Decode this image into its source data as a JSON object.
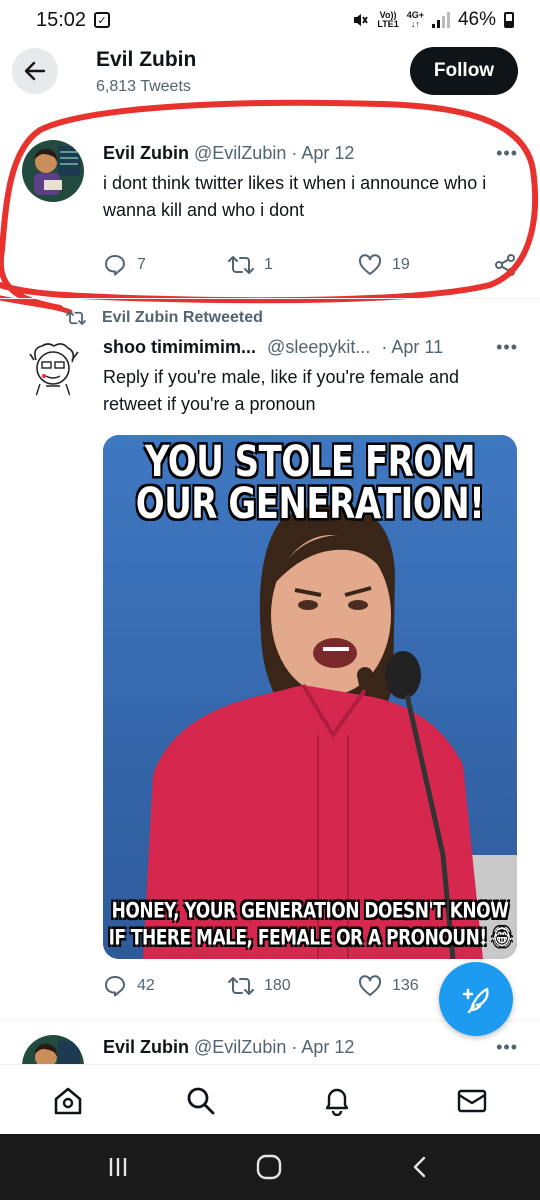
{
  "status_bar": {
    "time": "15:02",
    "net_top": "Vo))",
    "net_bottom": "LTE1",
    "gen_top": "4G+",
    "gen_bottom": "↓↑",
    "battery": "46%"
  },
  "header": {
    "title": "Evil Zubin",
    "subtitle": "6,813 Tweets",
    "follow_label": "Follow"
  },
  "tweets": [
    {
      "name": "Evil Zubin",
      "handle": "@EvilZubin",
      "date": "· Apr 12",
      "text": "i dont think twitter likes it when i announce who i wanna kill and who i dont",
      "replies": "7",
      "retweets": "1",
      "likes": "19"
    },
    {
      "retweeted_by": "Evil Zubin Retweeted",
      "name": "shoo timimimim...",
      "handle": "@sleepykit...",
      "date": "· Apr 11",
      "text": "Reply if you're male, like if you're female and retweet if you're a pronoun",
      "meme_top_1": "YOU STOLE FROM",
      "meme_top_2": "OUR GENERATION!",
      "meme_bottom_1": "HONEY, YOUR GENERATION DOESN'T KNOW",
      "meme_bottom_2": "IF THERE MALE, FEMALE OR A PRONOUN! 😂",
      "replies": "42",
      "retweets": "180",
      "likes": "136"
    },
    {
      "name": "Evil Zubin",
      "handle": "@EvilZubin",
      "date": "· Apr 12"
    }
  ],
  "colors": {
    "accent": "#1d9bf0",
    "annotation": "#e8322e",
    "text": "#0f1419",
    "secondary": "#536471"
  },
  "icons": [
    "back-arrow-icon",
    "reply-icon",
    "retweet-icon",
    "like-icon",
    "share-icon",
    "compose-icon",
    "home-icon",
    "search-icon",
    "notifications-icon",
    "messages-icon",
    "recents-icon",
    "home-circle-icon",
    "back-chevron-icon"
  ]
}
